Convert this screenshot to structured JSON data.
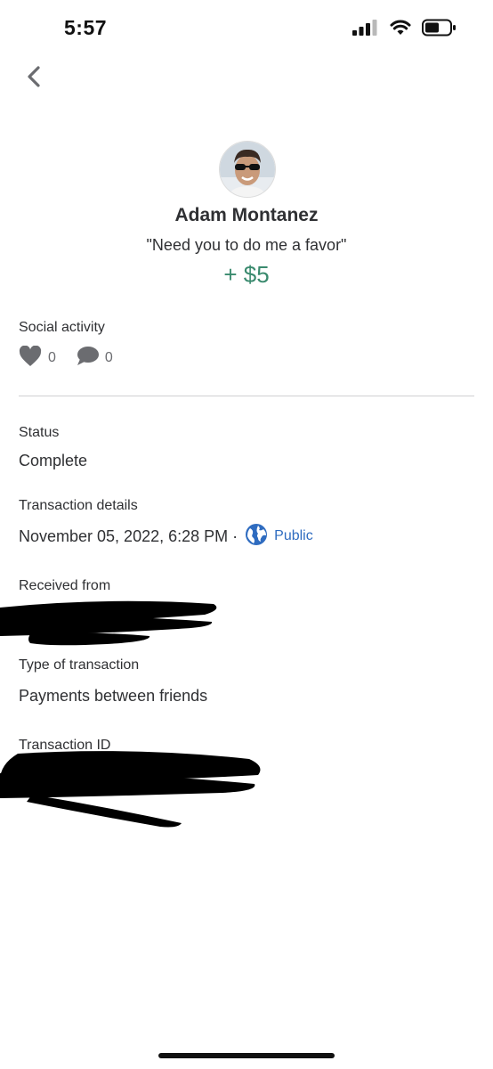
{
  "status_bar": {
    "time": "5:57",
    "icons": [
      "cellular-signal-icon",
      "wifi-icon",
      "battery-icon"
    ]
  },
  "nav": {
    "back_icon": "chevron-left-icon"
  },
  "transaction": {
    "name": "Adam Montanez",
    "note": "\"Need you to do me a favor\"",
    "amount": "+ $5",
    "amount_color": "#3a8a6e"
  },
  "social": {
    "label": "Social activity",
    "likes": "0",
    "comments": "0"
  },
  "status": {
    "label": "Status",
    "value": "Complete"
  },
  "details": {
    "label": "Transaction details",
    "datetime": "November 05, 2022, 6:28 PM ·",
    "privacy": "Public",
    "privacy_color": "#2f6cc0"
  },
  "received_from": {
    "label": "Received from"
  },
  "type": {
    "label": "Type of transaction",
    "value": "Payments between friends"
  },
  "transaction_id": {
    "label": "Transaction ID"
  }
}
